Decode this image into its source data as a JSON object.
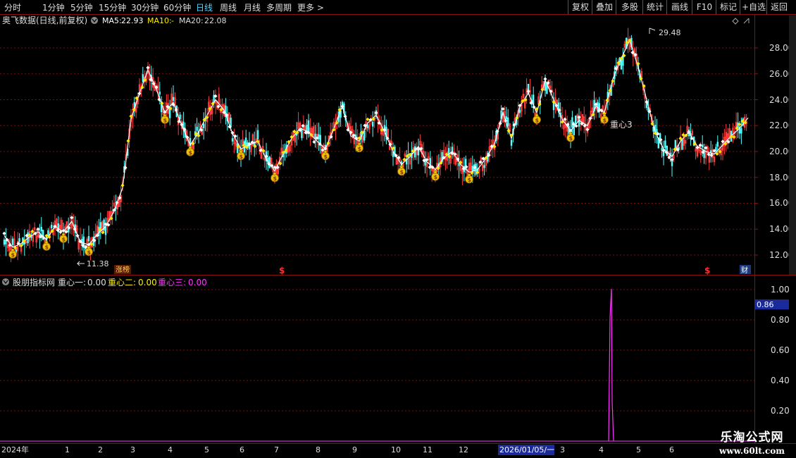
{
  "toolbar": {
    "periods": [
      "分时",
      "1分钟",
      "5分钟",
      "15分钟",
      "30分钟",
      "60分钟",
      "日线",
      "周线",
      "月线",
      "多周期",
      "更多"
    ],
    "active": "日线",
    "right_buttons": [
      "复权",
      "叠加",
      "多股",
      "统计",
      "画线",
      "F10",
      "标记",
      "+自选",
      "返回"
    ]
  },
  "main_panel": {
    "title": "奥飞数据(日线,前复权)",
    "ma5_label": "MA5:",
    "ma5_value": "22.93",
    "ma10_label": "MA10:",
    "ma10_value": "-",
    "ma20_label": "MA20:",
    "ma20_value": "22.08",
    "y_ticks": [
      "28.00",
      "26.00",
      "24.00",
      "22.00",
      "20.00",
      "18.00",
      "16.00",
      "14.00",
      "12.00"
    ],
    "high_marker": "29.48",
    "low_marker": "11.38",
    "center_label": "重心3",
    "badge_limit_up": "涨榜",
    "badge_money": "$",
    "badge_finance": "财"
  },
  "indicator_panel": {
    "title": "股朋指标网",
    "s1_label": "重心一:",
    "s1_value": "0.00",
    "s2_label": "重心二:",
    "s2_value": "0.00",
    "s3_label": "重心三:",
    "s3_value": "0.00",
    "y_ticks": [
      "1.00",
      "0.80",
      "0.60",
      "0.40",
      "0.20"
    ],
    "cursor_value": "0.86"
  },
  "time_axis": {
    "labels": [
      "2024年",
      "1",
      "2",
      "3",
      "4",
      "5",
      "6",
      "7",
      "8",
      "9",
      "10",
      "11",
      "12",
      "3",
      "4",
      "5",
      "6"
    ],
    "cursor_date": "2026/01/05/一"
  },
  "watermark": {
    "line1": "乐淘公式网",
    "line2": "www.60lt.com"
  },
  "colors": {
    "accent": "#4fd2ff",
    "candle_up": "#ff3b3b",
    "candle_down": "#54ffff",
    "ma5": "#ffffff",
    "ma20": "#ffee00",
    "indicator": "#ff33ff"
  },
  "chart_data": {
    "type": "line",
    "ylim": [
      11,
      30
    ],
    "series": [
      {
        "name": "MA5",
        "values": [
          13.5,
          12.6,
          12.9,
          13.4,
          13.8,
          13.2,
          14.2,
          13.8,
          14.6,
          13.0,
          12.8,
          13.6,
          14.2,
          15.4,
          17.2,
          22.5,
          24.5,
          26.3,
          24.8,
          23.0,
          23.8,
          22.0,
          20.5,
          21.5,
          22.8,
          24.0,
          23.2,
          21.4,
          20.2,
          20.5,
          20.8,
          19.4,
          18.5,
          19.8,
          21.0,
          21.8,
          21.5,
          20.8,
          20.2,
          21.8,
          23.5,
          21.2,
          20.8,
          22.2,
          22.8,
          21.5,
          20.0,
          19.0,
          19.6,
          20.4,
          19.2,
          18.6,
          19.5,
          20.0,
          19.0,
          18.4,
          18.6,
          19.5,
          20.6,
          23.0,
          21.0,
          23.5,
          24.5,
          23.0,
          25.5,
          24.0,
          22.5,
          21.6,
          22.4,
          22.0,
          23.5,
          23.0,
          25.6,
          27.2,
          28.6,
          26.5,
          24.0,
          21.5,
          20.2,
          19.6,
          20.8,
          21.5,
          20.4,
          20.0,
          19.8,
          20.5,
          21.2,
          21.8,
          22.6
        ]
      }
    ]
  }
}
